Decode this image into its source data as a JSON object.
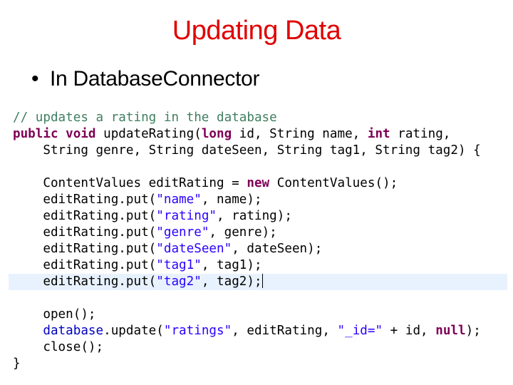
{
  "slide": {
    "title": "Updating Data",
    "bullet_marker": "•",
    "bullet": "In DatabaseConnector",
    "title_color": "#e00000"
  },
  "code": {
    "colors": {
      "comment": "#3f7f5f",
      "keyword": "#7f0055",
      "string": "#2a00ff",
      "field": "#0000c0",
      "highlight_line_bg": "#e8f2fe"
    },
    "highlighted_line": 10,
    "lines": [
      [
        {
          "t": "// updates a rating in the database",
          "c": "cmt"
        }
      ],
      [
        {
          "t": "public",
          "c": "kw"
        },
        {
          "t": " "
        },
        {
          "t": "void",
          "c": "kw"
        },
        {
          "t": " updateRating("
        },
        {
          "t": "long",
          "c": "kw"
        },
        {
          "t": " id, String name, "
        },
        {
          "t": "int",
          "c": "kw"
        },
        {
          "t": " rating,"
        }
      ],
      [
        {
          "t": "    String genre, String dateSeen, String tag1, String tag2) {"
        }
      ],
      [
        {
          "t": ""
        }
      ],
      [
        {
          "t": "    ContentValues editRating = "
        },
        {
          "t": "new",
          "c": "kw"
        },
        {
          "t": " ContentValues();"
        }
      ],
      [
        {
          "t": "    editRating.put("
        },
        {
          "t": "\"name\"",
          "c": "str"
        },
        {
          "t": ", name);"
        }
      ],
      [
        {
          "t": "    editRating.put("
        },
        {
          "t": "\"rating\"",
          "c": "str"
        },
        {
          "t": ", rating);"
        }
      ],
      [
        {
          "t": "    editRating.put("
        },
        {
          "t": "\"genre\"",
          "c": "str"
        },
        {
          "t": ", genre);"
        }
      ],
      [
        {
          "t": "    editRating.put("
        },
        {
          "t": "\"dateSeen\"",
          "c": "str"
        },
        {
          "t": ", dateSeen);"
        }
      ],
      [
        {
          "t": "    editRating.put("
        },
        {
          "t": "\"tag1\"",
          "c": "str"
        },
        {
          "t": ", tag1);"
        }
      ],
      [
        {
          "t": "    editRating.put("
        },
        {
          "t": "\"tag2\"",
          "c": "str"
        },
        {
          "t": ", tag2);"
        }
      ],
      [
        {
          "t": ""
        }
      ],
      [
        {
          "t": "    open();"
        }
      ],
      [
        {
          "t": "    "
        },
        {
          "t": "database",
          "c": "fld"
        },
        {
          "t": ".update("
        },
        {
          "t": "\"ratings\"",
          "c": "str"
        },
        {
          "t": ", editRating, "
        },
        {
          "t": "\"_id=\"",
          "c": "str"
        },
        {
          "t": " + id, "
        },
        {
          "t": "null",
          "c": "kw"
        },
        {
          "t": ");"
        }
      ],
      [
        {
          "t": "    close();"
        }
      ],
      [
        {
          "t": "}"
        }
      ]
    ]
  }
}
